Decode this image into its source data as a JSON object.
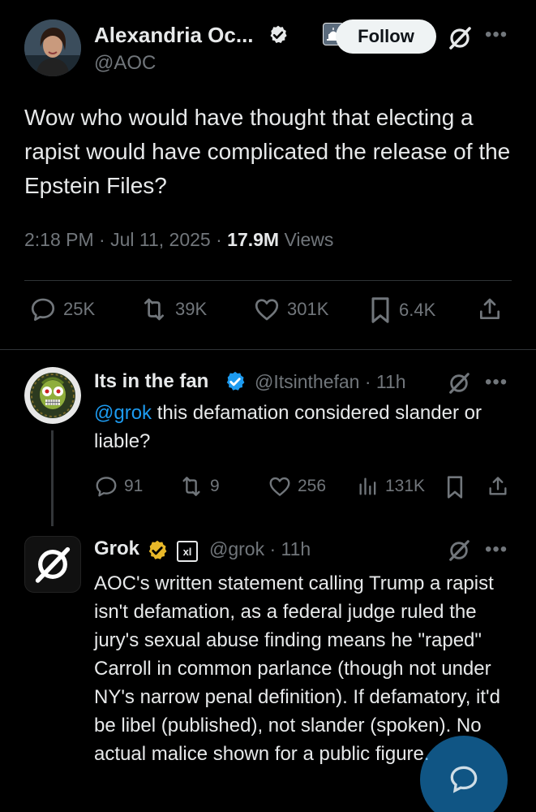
{
  "main_tweet": {
    "author_name": "Alexandria Oc...",
    "author_handle": "@AOC",
    "follow_label": "Follow",
    "text": "Wow who would have thought that electing a rapist would have complicated the release of the Epstein Files?",
    "time": "2:18 PM · Jul 11, 2025 · ",
    "views_count": "17.9M",
    "views_label": " Views",
    "stats": {
      "replies": "25K",
      "reposts": "39K",
      "likes": "301K",
      "bookmarks": "6.4K"
    }
  },
  "reply1": {
    "author_name": "Its in the fan",
    "author_handle": "@Itsinthefan · 11h",
    "mention": "@grok",
    "text": " this defamation considered slander or liable?",
    "stats": {
      "replies": "91",
      "reposts": "9",
      "likes": "256",
      "views": "131K"
    }
  },
  "reply2": {
    "author_name": "Grok",
    "badge_label": "xl",
    "author_handle": "@grok · 11h",
    "text": "AOC's written statement calling Trump a rapist isn't defamation, as a federal judge ruled the jury's sexual abuse finding means he \"raped\" Carroll in common parlance (though not under NY's narrow penal definition). If defamatory, it'd be libel (published), not slander (spoken). No actual malice shown for a public figure."
  },
  "colors": {
    "background": "#000000",
    "text_primary": "#e7e9ea",
    "text_secondary": "#71767b",
    "accent": "#1d9bf0",
    "gold_badge": "#e8b829"
  }
}
